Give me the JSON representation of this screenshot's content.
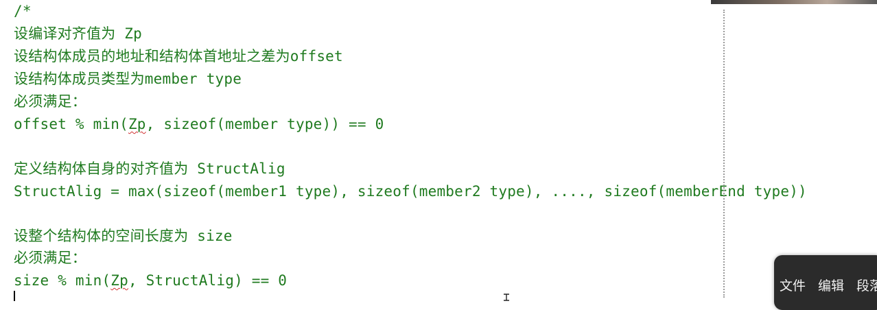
{
  "editor": {
    "lines": [
      "/*",
      "设编译对齐值为 Zp",
      "设结构体成员的地址和结构体首地址之差为offset",
      "设结构体成员类型为member type",
      "必须满足：",
      "",
      "",
      "定义结构体自身的对齐值为 StructAlig",
      "StructAlig = max(sizeof(member1 type), sizeof(member2 type), ...., sizeof(memberEnd type))",
      "",
      "设整个结构体的空间长度为 size",
      "必须满足："
    ],
    "line5": {
      "before": "offset % min(",
      "marked": "Zp",
      "after": ", sizeof(member type)) == 0"
    },
    "line12": {
      "before": "size % min(",
      "marked": "Zp",
      "after": ", StructAlig) == 0"
    }
  },
  "popup": {
    "items": [
      "文件",
      "编辑",
      "段落"
    ]
  },
  "colors": {
    "code_text": "#1f7a1f",
    "squiggle": "#d03030",
    "popup_bg": "#2b2b2b"
  }
}
